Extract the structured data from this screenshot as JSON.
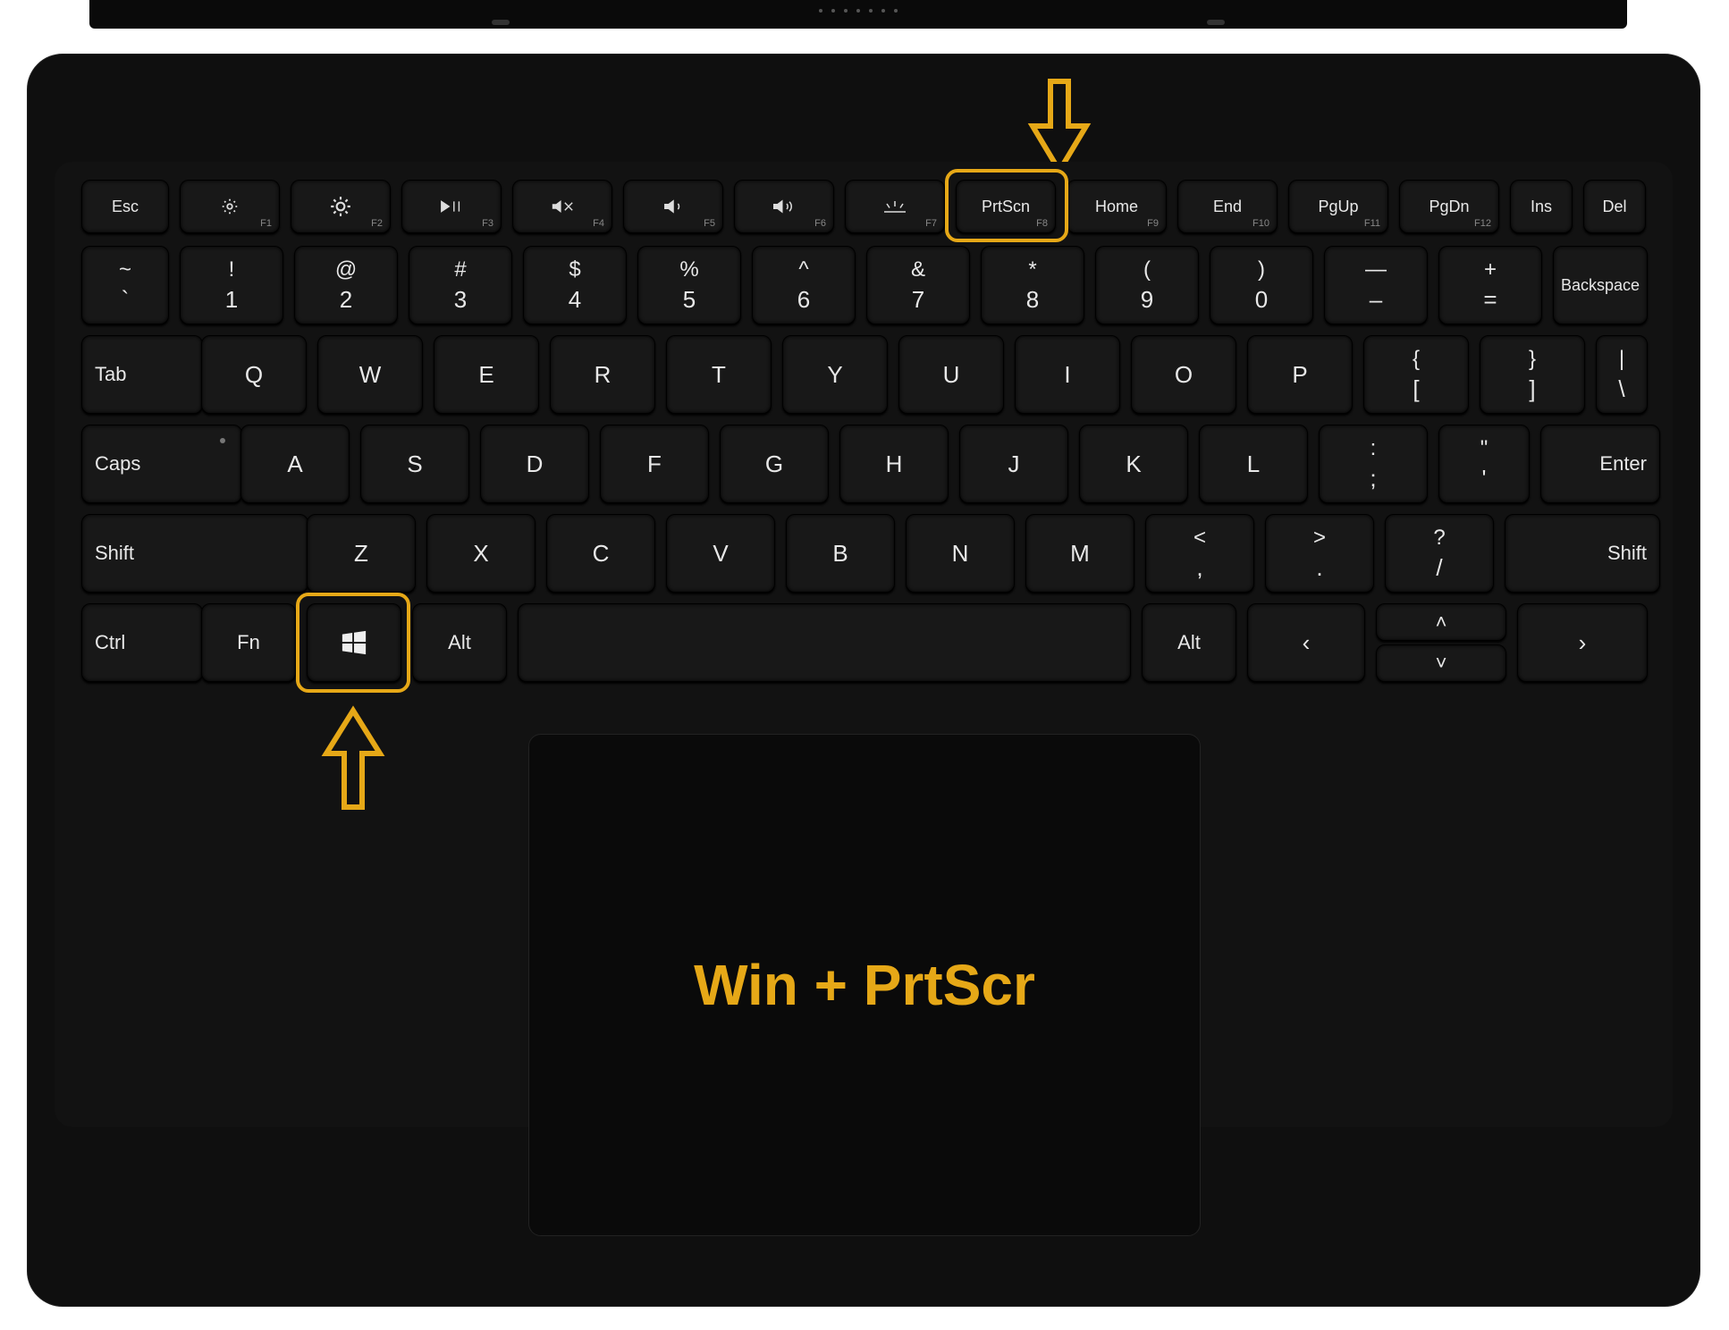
{
  "annotations": {
    "caption": "Win + PrtScr",
    "highlight_color": "#e6a817"
  },
  "keys": {
    "esc": "Esc",
    "prtscn": "PrtScn",
    "home": "Home",
    "end": "End",
    "pgup": "PgUp",
    "pgdn": "PgDn",
    "ins": "Ins",
    "del": "Del",
    "f1": "F1",
    "f2": "F2",
    "f3": "F3",
    "f4": "F4",
    "f5": "F5",
    "f6": "F6",
    "f7": "F7",
    "f8": "F8",
    "f9": "F9",
    "f10": "F10",
    "f11": "F11",
    "f12": "F12",
    "tilde_a": "~",
    "tilde_b": "`",
    "1a": "!",
    "1b": "1",
    "2a": "@",
    "2b": "2",
    "3a": "#",
    "3b": "3",
    "4a": "$",
    "4b": "4",
    "5a": "%",
    "5b": "5",
    "6a": "^",
    "6b": "6",
    "7a": "&",
    "7b": "7",
    "8a": "*",
    "8b": "8",
    "9a": "(",
    "9b": "9",
    "0a": ")",
    "0b": "0",
    "minus_a": "—",
    "minus_b": "–",
    "eq_a": "+",
    "eq_b": "=",
    "backspace": "Backspace",
    "tab": "Tab",
    "q": "Q",
    "w": "W",
    "e": "E",
    "r": "R",
    "t": "T",
    "y": "Y",
    "u": "U",
    "i": "I",
    "o": "O",
    "p": "P",
    "lb_a": "{",
    "lb_b": "[",
    "rb_a": "}",
    "rb_b": "]",
    "bs_a": "|",
    "bs_b": "\\",
    "caps": "Caps",
    "a": "A",
    "s": "S",
    "d": "D",
    "f": "F",
    "g": "G",
    "h": "H",
    "j": "J",
    "k": "K",
    "l": "L",
    "semi_a": ":",
    "semi_b": ";",
    "quote_a": "\"",
    "quote_b": "'",
    "enter": "Enter",
    "lshift": "Shift",
    "z": "Z",
    "x": "X",
    "c": "C",
    "v": "V",
    "b": "B",
    "n": "N",
    "m": "M",
    "comma_a": "<",
    "comma_b": ",",
    "dot_a": ">",
    "dot_b": ".",
    "slash_a": "?",
    "slash_b": "/",
    "rshift": "Shift",
    "ctrl": "Ctrl",
    "fn": "Fn",
    "alt": "Alt",
    "ralt": "Alt",
    "left": "‹",
    "right": "›",
    "up": "˄",
    "down": "˅"
  }
}
